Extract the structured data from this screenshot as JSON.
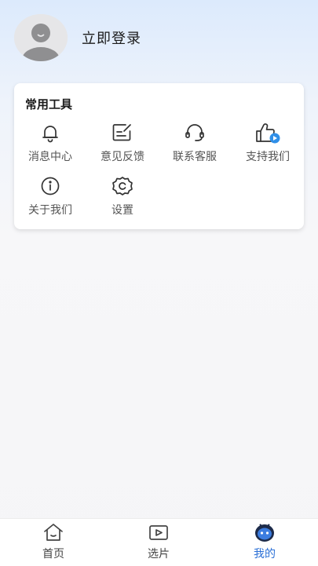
{
  "profile": {
    "login_label": "立即登录",
    "avatar_icon": "default-user-avatar-icon"
  },
  "tools": {
    "title": "常用工具",
    "items": [
      {
        "label": "消息中心",
        "icon": "bell-icon"
      },
      {
        "label": "意见反馈",
        "icon": "feedback-edit-icon"
      },
      {
        "label": "联系客服",
        "icon": "headset-icon"
      },
      {
        "label": "支持我们",
        "icon": "thumbs-up-play-icon"
      },
      {
        "label": "关于我们",
        "icon": "info-circle-icon"
      },
      {
        "label": "设置",
        "icon": "settings-gear-icon"
      }
    ]
  },
  "tabbar": {
    "items": [
      {
        "label": "首页",
        "icon": "home-icon",
        "active": false
      },
      {
        "label": "选片",
        "icon": "video-play-icon",
        "active": false
      },
      {
        "label": "我的",
        "icon": "mascot-face-icon",
        "active": true
      }
    ]
  },
  "colors": {
    "accent": "#2a6fd6",
    "support_badge": "#2f8fe8"
  }
}
